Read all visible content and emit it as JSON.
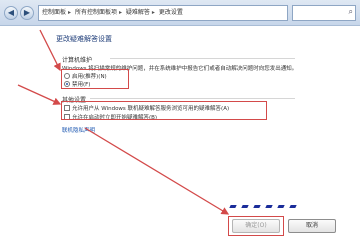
{
  "nav": {
    "back_icon": "back-arrow-icon",
    "forward_icon": "forward-arrow-icon",
    "breadcrumbs": [
      "控制面板",
      "所有控制面板项",
      "疑难解答",
      "更改设置"
    ],
    "separator": "▸",
    "search_icon": "search-icon"
  },
  "page": {
    "title": "更改疑难解答设置"
  },
  "maintenance": {
    "section_title": "计算机维护",
    "description": "Windows 将扫描常规的维护问题，并在系统维护中报告它们或者自动解决问题时向您发出通知。",
    "options": [
      {
        "label": "启用(推荐)(N)",
        "selected": false
      },
      {
        "label": "禁用(F)",
        "selected": true
      }
    ]
  },
  "other": {
    "section_title": "其他设置",
    "checkboxes": [
      {
        "label": "允许用户从 Windows 联机疑难解答服务浏览可用的疑难解答(A)",
        "checked": false
      },
      {
        "label": "允许在启动时立即开始疑难解答(B)",
        "checked": false
      }
    ],
    "privacy_link": "联机隐私声明"
  },
  "buttons": {
    "ok": "确定(O)",
    "cancel": "取消"
  },
  "colors": {
    "highlight": "#d34a4a",
    "link": "#1b56b0",
    "title": "#1e3c78"
  }
}
